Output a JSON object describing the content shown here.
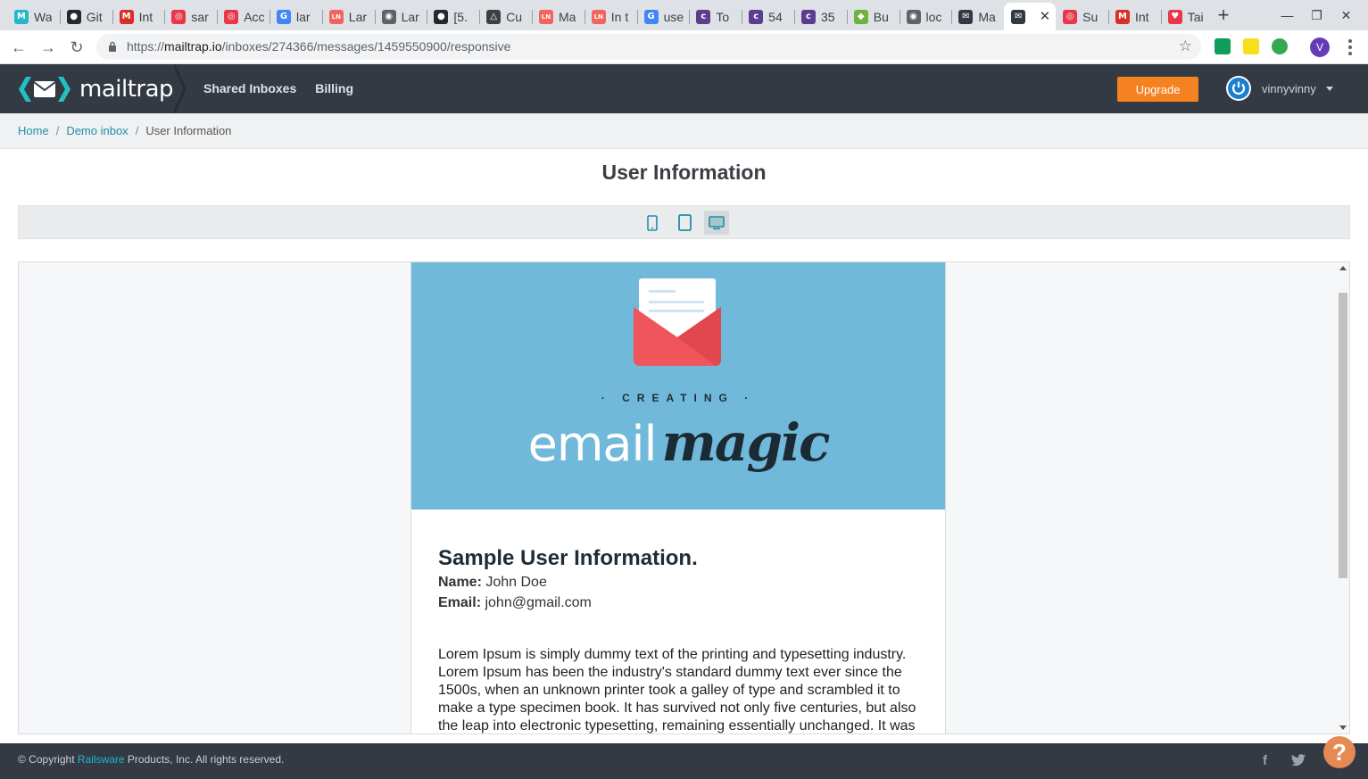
{
  "browser": {
    "tabs": [
      {
        "label": "Wa",
        "icon": "mailtrap-m-icon",
        "color": "#22b8c7",
        "glyph": "M"
      },
      {
        "label": "Git",
        "icon": "github-icon",
        "color": "#24292e",
        "glyph": "●"
      },
      {
        "label": "Int",
        "icon": "gmail-icon",
        "color": "#d93025",
        "glyph": "M"
      },
      {
        "label": "sar",
        "icon": "target-icon",
        "color": "#e8374a",
        "glyph": "◎"
      },
      {
        "label": "Acc",
        "icon": "target-icon",
        "color": "#e8374a",
        "glyph": "◎"
      },
      {
        "label": "lar",
        "icon": "google-icon",
        "color": "#4285f4",
        "glyph": "G"
      },
      {
        "label": "Lar",
        "icon": "laravel-news-icon",
        "color": "#f4645f",
        "glyph": "LN"
      },
      {
        "label": "Lar",
        "icon": "globe-icon",
        "color": "#5f6368",
        "glyph": "◉"
      },
      {
        "label": "[5.",
        "icon": "github-icon",
        "color": "#24292e",
        "glyph": "●"
      },
      {
        "label": "Cu",
        "icon": "triangle-icon",
        "color": "#3c4043",
        "glyph": "△"
      },
      {
        "label": "Ma",
        "icon": "laravel-news-icon",
        "color": "#f4645f",
        "glyph": "LN"
      },
      {
        "label": "In t",
        "icon": "laravel-news-icon",
        "color": "#f4645f",
        "glyph": "LN"
      },
      {
        "label": "use",
        "icon": "google-icon",
        "color": "#4285f4",
        "glyph": "G"
      },
      {
        "label": "To",
        "icon": "colorlib-icon",
        "color": "#5c3d8f",
        "glyph": "c"
      },
      {
        "label": "54",
        "icon": "colorlib-icon",
        "color": "#5c3d8f",
        "glyph": "c"
      },
      {
        "label": "35",
        "icon": "colorlib-icon",
        "color": "#5c3d8f",
        "glyph": "c"
      },
      {
        "label": "Bu",
        "icon": "leaf-icon",
        "color": "#6db33f",
        "glyph": "◆"
      },
      {
        "label": "loc",
        "icon": "globe-icon",
        "color": "#5f6368",
        "glyph": "◉"
      },
      {
        "label": "Ma",
        "icon": "mailtrap-icon",
        "color": "#333a43",
        "glyph": "✉"
      },
      {
        "label": "",
        "icon": "mailtrap-icon",
        "color": "#333a43",
        "glyph": "✉",
        "active": true
      },
      {
        "label": "Su",
        "icon": "target-icon",
        "color": "#e8374a",
        "glyph": "◎"
      },
      {
        "label": "Int",
        "icon": "gmail-icon",
        "color": "#d93025",
        "glyph": "M"
      },
      {
        "label": "Tai",
        "icon": "heart-icon",
        "color": "#e8374a",
        "glyph": "♥"
      }
    ],
    "url_host": "mailtrap.io",
    "url_scheme": "https://",
    "url_path": "/inboxes/274366/messages/1459550900/responsive",
    "profile_initial": "V"
  },
  "header": {
    "logo_text": "mailtrap",
    "nav": [
      "Shared Inboxes",
      "Billing"
    ],
    "upgrade_label": "Upgrade",
    "username": "vinnyvinny"
  },
  "breadcrumb": {
    "home": "Home",
    "inbox": "Demo inbox",
    "current": "User Information"
  },
  "message": {
    "subject": "User Information",
    "view_modes": [
      "mobile",
      "tablet",
      "desktop"
    ],
    "selected_view": "desktop"
  },
  "email": {
    "hero_creating": "· CREATING ·",
    "hero_email": "email",
    "hero_magic": "magic",
    "title": "Sample User Information.",
    "name_label": "Name:",
    "name_value": "John Doe",
    "email_label": "Email:",
    "email_value": "john@gmail.com",
    "paragraph": "Lorem Ipsum is simply dummy text of the printing and typesetting industry. Lorem Ipsum has been the industry's standard dummy text ever since the 1500s, when an unknown printer took a galley of type and scrambled it to make a type specimen book. It has survived not only five centuries, but also the leap into electronic typesetting, remaining essentially unchanged. It was"
  },
  "footer": {
    "copy_prefix": "© Copyright",
    "company_link": "Railsware",
    "copy_suffix": "Products, Inc. All rights reserved."
  },
  "colors": {
    "header_bg": "#333a43",
    "accent_teal": "#1e8fa5",
    "upgrade_orange": "#f58220",
    "hero_blue": "#71b9da",
    "envelope_red": "#f1555c"
  }
}
